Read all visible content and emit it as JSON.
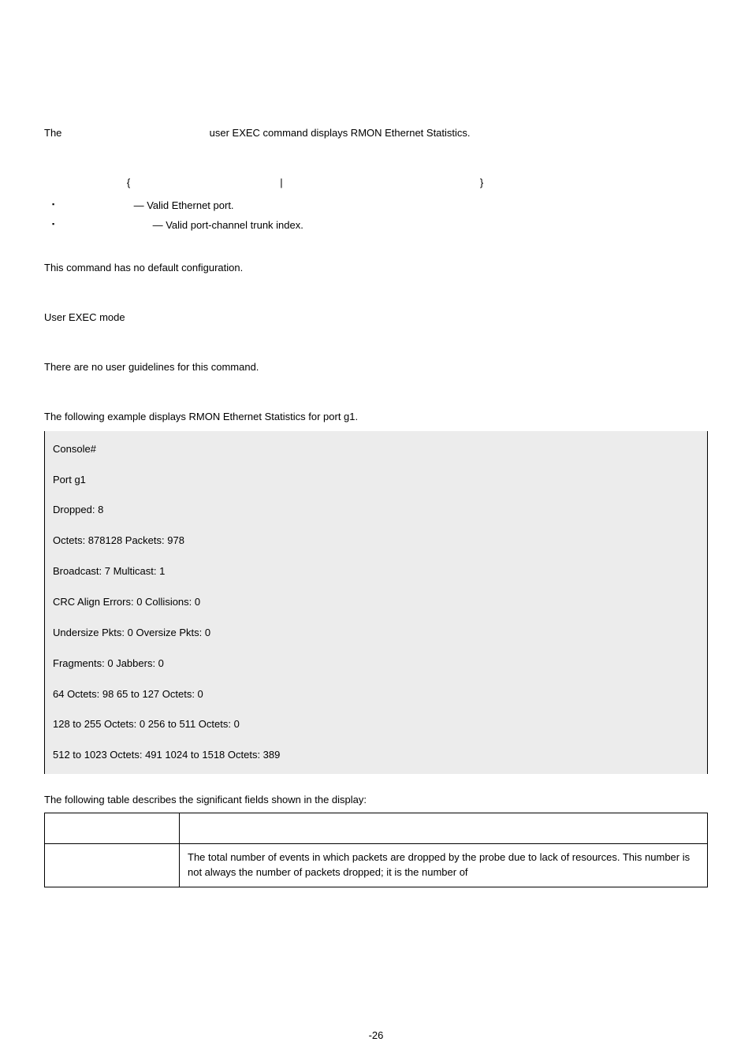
{
  "intro": {
    "prefix": "The ",
    "suffix": " user EXEC command displays RMON Ethernet Statistics."
  },
  "syntax": {
    "open": "{",
    "pipe": "|",
    "close": "}"
  },
  "bullets": {
    "b1": " — Valid Ethernet port.",
    "b2": " — Valid port-channel trunk index."
  },
  "default_cfg": "This command has no default configuration.",
  "mode": "User EXEC mode",
  "guidelines": "There are no user guidelines for this command.",
  "example_intro": "The following example displays RMON Ethernet Statistics for port g1.",
  "code": {
    "l1": "Console#",
    "l2": "Port g1",
    "l3": "Dropped: 8",
    "l4": "Octets: 878128 Packets: 978",
    "l5": "Broadcast: 7 Multicast: 1",
    "l6": "CRC Align Errors: 0 Collisions: 0",
    "l7": "Undersize Pkts: 0 Oversize Pkts: 0",
    "l8": "Fragments: 0 Jabbers: 0",
    "l9": "64 Octets: 98 65 to 127 Octets: 0",
    "l10": "128 to 255 Octets: 0 256 to 511 Octets: 0",
    "l11": "512 to 1023 Octets: 491 1024 to 1518 Octets: 389"
  },
  "table_intro": "The following table describes the significant fields shown in the display:",
  "table": {
    "h1": "",
    "h2": "",
    "r1c1": "",
    "r1c2": "The total number of events in which packets are dropped by the probe due to lack of resources. This number is not always the number of packets dropped; it is the number of"
  },
  "footer": "-26",
  "chart_data": {
    "type": "table",
    "port": "g1",
    "dropped": 8,
    "octets": 878128,
    "packets": 978,
    "broadcast": 7,
    "multicast": 1,
    "crc_align_errors": 0,
    "collisions": 0,
    "undersize_pkts": 0,
    "oversize_pkts": 0,
    "fragments": 0,
    "jabbers": 0,
    "size_distribution": {
      "64": 98,
      "65_127": 0,
      "128_255": 0,
      "256_511": 0,
      "512_1023": 491,
      "1024_1518": 389
    }
  }
}
